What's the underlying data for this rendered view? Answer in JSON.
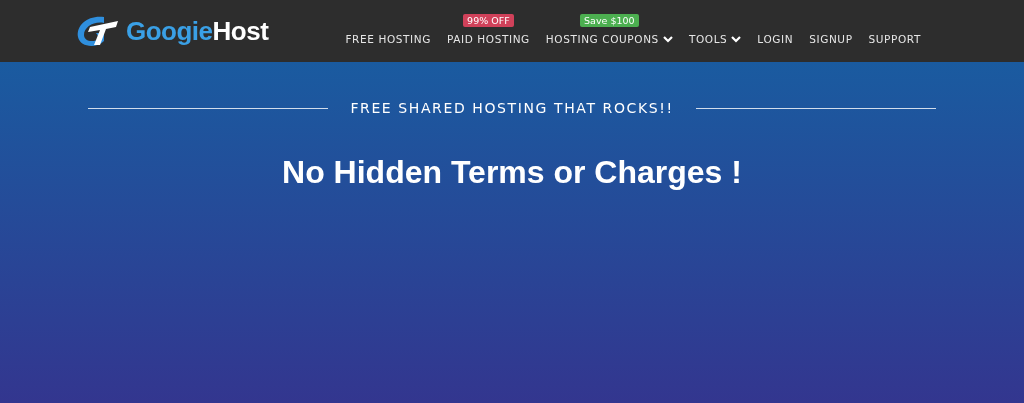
{
  "logo": {
    "part1": "Googie",
    "part2": "Host"
  },
  "nav": [
    {
      "label": "FREE HOSTING",
      "dropdown": false
    },
    {
      "label": "PAID HOSTING",
      "dropdown": false,
      "badge": {
        "text": "99% OFF",
        "color": "#d0415a"
      }
    },
    {
      "label": "HOSTING COUPONS",
      "dropdown": true,
      "badge": {
        "text": "Save $100",
        "color": "#4caf50"
      }
    },
    {
      "label": "TOOLS",
      "dropdown": true
    },
    {
      "label": "LOGIN",
      "dropdown": false
    },
    {
      "label": "SIGNUP",
      "dropdown": false
    },
    {
      "label": "SUPPORT",
      "dropdown": false
    }
  ],
  "hero": {
    "tagline": "FREE SHARED HOSTING THAT ROCKS!!",
    "heading": "No Hidden Terms or Charges !"
  }
}
